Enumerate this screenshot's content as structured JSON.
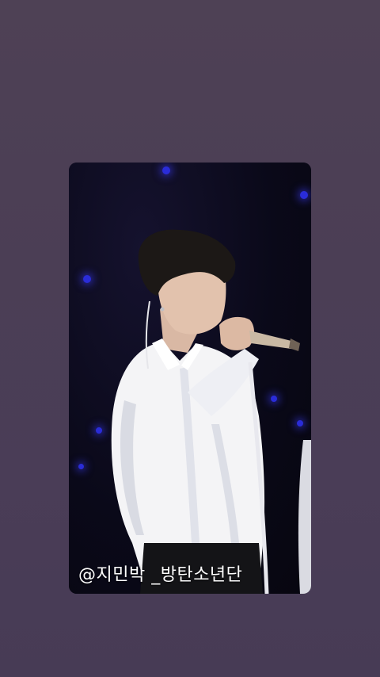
{
  "story": {
    "caption": "@지민박 _방탄소년단",
    "colors": {
      "background": "#4b3e55",
      "stage": "#0d0b1e",
      "stage_light": "#2a2cd8",
      "shirt": "#f4f4f6",
      "hair": "#1c1816"
    }
  }
}
